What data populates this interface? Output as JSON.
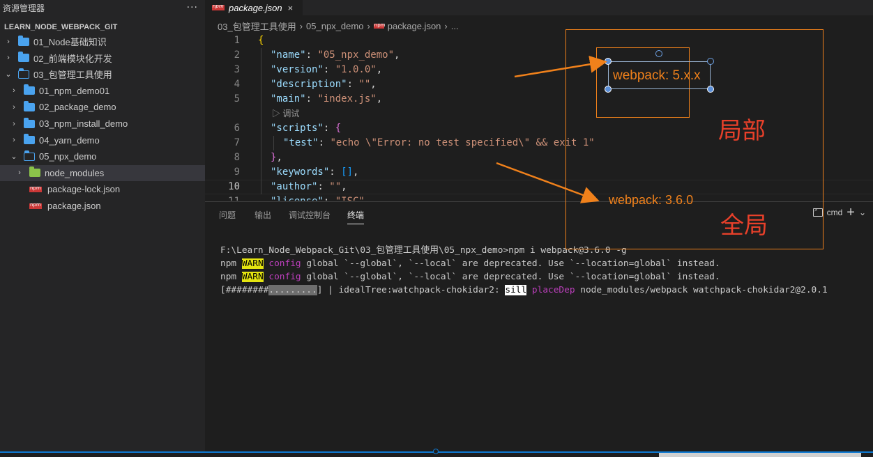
{
  "sidebar": {
    "title": "资源管理器",
    "more": "···",
    "project": "LEARN_NODE_WEBPACK_GIT",
    "items": [
      {
        "label": "01_Node基础知识",
        "type": "folder",
        "expanded": false,
        "depth": 0
      },
      {
        "label": "02_前端模块化开发",
        "type": "folder",
        "expanded": false,
        "depth": 0
      },
      {
        "label": "03_包管理工具使用",
        "type": "folder",
        "expanded": true,
        "depth": 0
      },
      {
        "label": "01_npm_demo01",
        "type": "folder",
        "expanded": false,
        "depth": 1
      },
      {
        "label": "02_package_demo",
        "type": "folder",
        "expanded": false,
        "depth": 1
      },
      {
        "label": "03_npm_install_demo",
        "type": "folder",
        "expanded": false,
        "depth": 1
      },
      {
        "label": "04_yarn_demo",
        "type": "folder",
        "expanded": false,
        "depth": 1
      },
      {
        "label": "05_npx_demo",
        "type": "folder",
        "expanded": true,
        "depth": 1
      },
      {
        "label": "node_modules",
        "type": "node_modules",
        "expanded": false,
        "depth": 2
      },
      {
        "label": "package-lock.json",
        "type": "npm",
        "depth": 2
      },
      {
        "label": "package.json",
        "type": "npm",
        "depth": 2
      }
    ]
  },
  "tab": {
    "label": "package.json",
    "close": "×"
  },
  "breadcrumb": {
    "parts": [
      "03_包管理工具使用",
      "05_npx_demo",
      "package.json",
      "..."
    ]
  },
  "editor": {
    "lines": [
      {
        "n": "1",
        "segs": [
          [
            "br1",
            "{"
          ]
        ]
      },
      {
        "n": "2",
        "segs": [
          [
            "key",
            "\"name\""
          ],
          [
            "pun",
            ": "
          ],
          [
            "str",
            "\"05_npx_demo\""
          ],
          [
            "pun",
            ","
          ]
        ]
      },
      {
        "n": "3",
        "segs": [
          [
            "key",
            "\"version\""
          ],
          [
            "pun",
            ": "
          ],
          [
            "str",
            "\"1.0.0\""
          ],
          [
            "pun",
            ","
          ]
        ]
      },
      {
        "n": "4",
        "segs": [
          [
            "key",
            "\"description\""
          ],
          [
            "pun",
            ": "
          ],
          [
            "str",
            "\"\""
          ],
          [
            "pun",
            ","
          ]
        ]
      },
      {
        "n": "5",
        "segs": [
          [
            "key",
            "\"main\""
          ],
          [
            "pun",
            ": "
          ],
          [
            "str",
            "\"index.js\""
          ],
          [
            "pun",
            ","
          ]
        ]
      },
      {
        "n": "6",
        "segs": [
          [
            "key",
            "\"scripts\""
          ],
          [
            "pun",
            ": "
          ],
          [
            "br2",
            "{"
          ]
        ]
      },
      {
        "n": "7",
        "segs": [
          [
            "key",
            "\"test\""
          ],
          [
            "pun",
            ": "
          ],
          [
            "str",
            "\"echo \\\"Error: no test specified\\\" && exit 1\""
          ]
        ]
      },
      {
        "n": "8",
        "segs": [
          [
            "br2",
            "}"
          ],
          [
            "pun",
            ","
          ]
        ]
      },
      {
        "n": "9",
        "segs": [
          [
            "key",
            "\"keywords\""
          ],
          [
            "pun",
            ": "
          ],
          [
            "br3",
            "[]"
          ],
          [
            "pun",
            ","
          ]
        ]
      },
      {
        "n": "10",
        "segs": [
          [
            "key",
            "\"author\""
          ],
          [
            "pun",
            ": "
          ],
          [
            "str",
            "\"\""
          ],
          [
            "pun",
            ","
          ]
        ]
      },
      {
        "n": "11",
        "segs": [
          [
            "key",
            "\"license\""
          ],
          [
            "pun",
            ": "
          ],
          [
            "str",
            "\"ISC\""
          ]
        ]
      }
    ],
    "codelens": "▷ 调试"
  },
  "panel": {
    "tabs": [
      "问题",
      "输出",
      "调试控制台",
      "终端"
    ],
    "shell": "cmd",
    "plus": "+",
    "chevron": "⌄",
    "terminal": {
      "cmd": "F:\\Learn_Node_Webpack_Git\\03_包管理工具使用\\05_npx_demo>npm i webpack@3.6.0 -g",
      "warn_prefix": "npm ",
      "warn_label": "WARN",
      "warn_cfg": "config",
      "warn_msg": " global `--global`, `--local` are deprecated. Use `--location=global` instead.",
      "progress_open": "[",
      "progress_done": "########",
      "progress_rest": ".........",
      "progress_close": "] | idealTree:watchpack-chokidar2: ",
      "sill": "sill",
      "placedep": "placeDep",
      "progress_tail": " node_modules/webpack watchpack-chokidar2@2.0.1"
    }
  },
  "annotations": {
    "local_version": "webpack: 5.x.x",
    "global_version": "webpack: 3.6.0",
    "local_label": "局部",
    "global_label": "全局"
  }
}
